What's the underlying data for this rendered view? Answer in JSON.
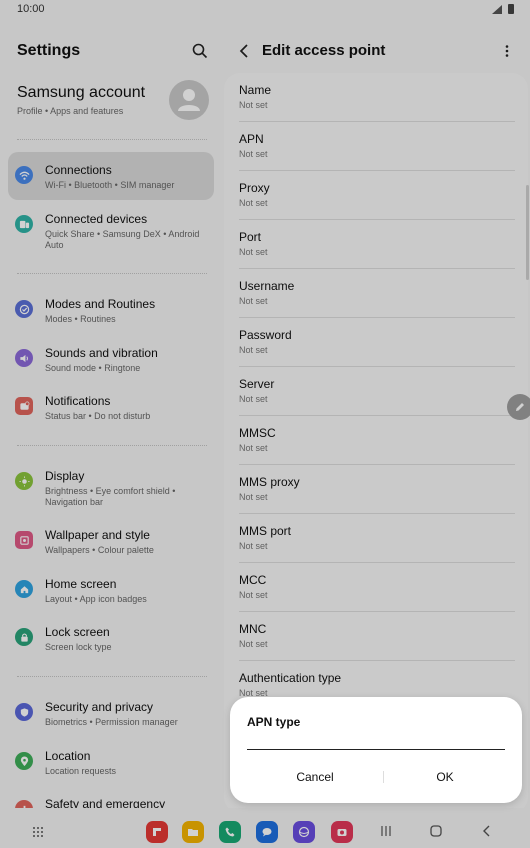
{
  "status_bar": {
    "time": "10:00"
  },
  "settings": {
    "title": "Settings",
    "account": {
      "title": "Samsung account",
      "subtitle": "Profile  •  Apps and features"
    },
    "items": [
      {
        "title": "Connections",
        "subtitle": "Wi-Fi  •  Bluetooth  •  SIM manager",
        "color": "#4a89e8",
        "icon": "wifi-icon"
      },
      {
        "title": "Connected devices",
        "subtitle": "Quick Share  •  Samsung DeX  •  Android Auto",
        "color": "#2fb3a6",
        "icon": "devices-icon"
      },
      {
        "title": "Modes and Routines",
        "subtitle": "Modes  •  Routines",
        "color": "#5b6fd6",
        "icon": "check-circle-icon"
      },
      {
        "title": "Sounds and vibration",
        "subtitle": "Sound mode  •  Ringtone",
        "color": "#8b6ad8",
        "icon": "speaker-icon"
      },
      {
        "title": "Notifications",
        "subtitle": "Status bar  •  Do not disturb",
        "color": "#e0645c",
        "icon": "bell-icon"
      },
      {
        "title": "Display",
        "subtitle": "Brightness  •  Eye comfort shield  •  Navigation bar",
        "color": "#8ac43c",
        "icon": "sun-icon"
      },
      {
        "title": "Wallpaper and style",
        "subtitle": "Wallpapers  •  Colour palette",
        "color": "#df5a86",
        "icon": "image-icon"
      },
      {
        "title": "Home screen",
        "subtitle": "Layout  •  App icon badges",
        "color": "#2fa3e0",
        "icon": "home-icon"
      },
      {
        "title": "Lock screen",
        "subtitle": "Screen lock type",
        "color": "#2aa37a",
        "icon": "lock-icon"
      },
      {
        "title": "Security and privacy",
        "subtitle": "Biometrics  •  Permission manager",
        "color": "#5b68d8",
        "icon": "shield-icon"
      },
      {
        "title": "Location",
        "subtitle": "Location requests",
        "color": "#3fae5a",
        "icon": "location-pin-icon"
      },
      {
        "title": "Safety and emergency",
        "subtitle": "",
        "color": "#e0645c",
        "icon": "emergency-icon"
      }
    ]
  },
  "apn": {
    "title": "Edit access point",
    "fields": [
      {
        "label": "Name",
        "value": "Not set"
      },
      {
        "label": "APN",
        "value": "Not set"
      },
      {
        "label": "Proxy",
        "value": "Not set"
      },
      {
        "label": "Port",
        "value": "Not set"
      },
      {
        "label": "Username",
        "value": "Not set"
      },
      {
        "label": "Password",
        "value": "Not set"
      },
      {
        "label": "Server",
        "value": "Not set"
      },
      {
        "label": "MMSC",
        "value": "Not set"
      },
      {
        "label": "MMS proxy",
        "value": "Not set"
      },
      {
        "label": "MMS port",
        "value": "Not set"
      },
      {
        "label": "MCC",
        "value": "Not set"
      },
      {
        "label": "MNC",
        "value": "Not set"
      },
      {
        "label": "Authentication type",
        "value": "Not set"
      }
    ]
  },
  "dialog": {
    "title": "APN type",
    "value": "",
    "cancel": "Cancel",
    "ok": "OK"
  },
  "navbar": {
    "apps": [
      {
        "icon": "flipboard-icon",
        "color": "#e53935"
      },
      {
        "icon": "folder-icon",
        "color": "#f5b400"
      },
      {
        "icon": "phone-icon",
        "color": "#19a974"
      },
      {
        "icon": "messages-icon",
        "color": "#1e6fe0"
      },
      {
        "icon": "internet-icon",
        "color": "#6a4ee0"
      },
      {
        "icon": "camera-icon",
        "color": "#e2375a"
      }
    ]
  }
}
